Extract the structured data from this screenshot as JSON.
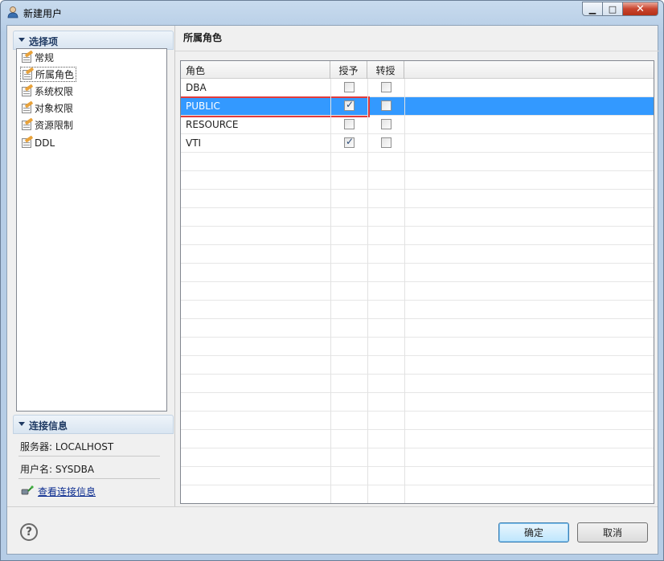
{
  "window": {
    "title": "新建用户"
  },
  "sidebar": {
    "section_title": "选择项",
    "items": [
      {
        "label": "常规"
      },
      {
        "label": "所属角色",
        "selected": true
      },
      {
        "label": "系统权限"
      },
      {
        "label": "对象权限"
      },
      {
        "label": "资源限制"
      },
      {
        "label": "DDL"
      }
    ]
  },
  "connection": {
    "section_title": "连接信息",
    "server": "服务器: LOCALHOST",
    "user": "用户名: SYSDBA",
    "view_link": "查看连接信息"
  },
  "main": {
    "title": "所属角色",
    "columns": [
      "角色",
      "授予",
      "转授"
    ],
    "rows": [
      {
        "role": "DBA",
        "grant": false,
        "transfer": false
      },
      {
        "role": "PUBLIC",
        "grant": true,
        "transfer": false,
        "selected": true
      },
      {
        "role": "RESOURCE",
        "grant": false,
        "transfer": false
      },
      {
        "role": "VTI",
        "grant": true,
        "transfer": false
      }
    ]
  },
  "footer": {
    "ok_label": "确定",
    "cancel_label": "取消"
  },
  "colors": {
    "selection": "#3399ff",
    "highlight": "#e23b3b"
  }
}
